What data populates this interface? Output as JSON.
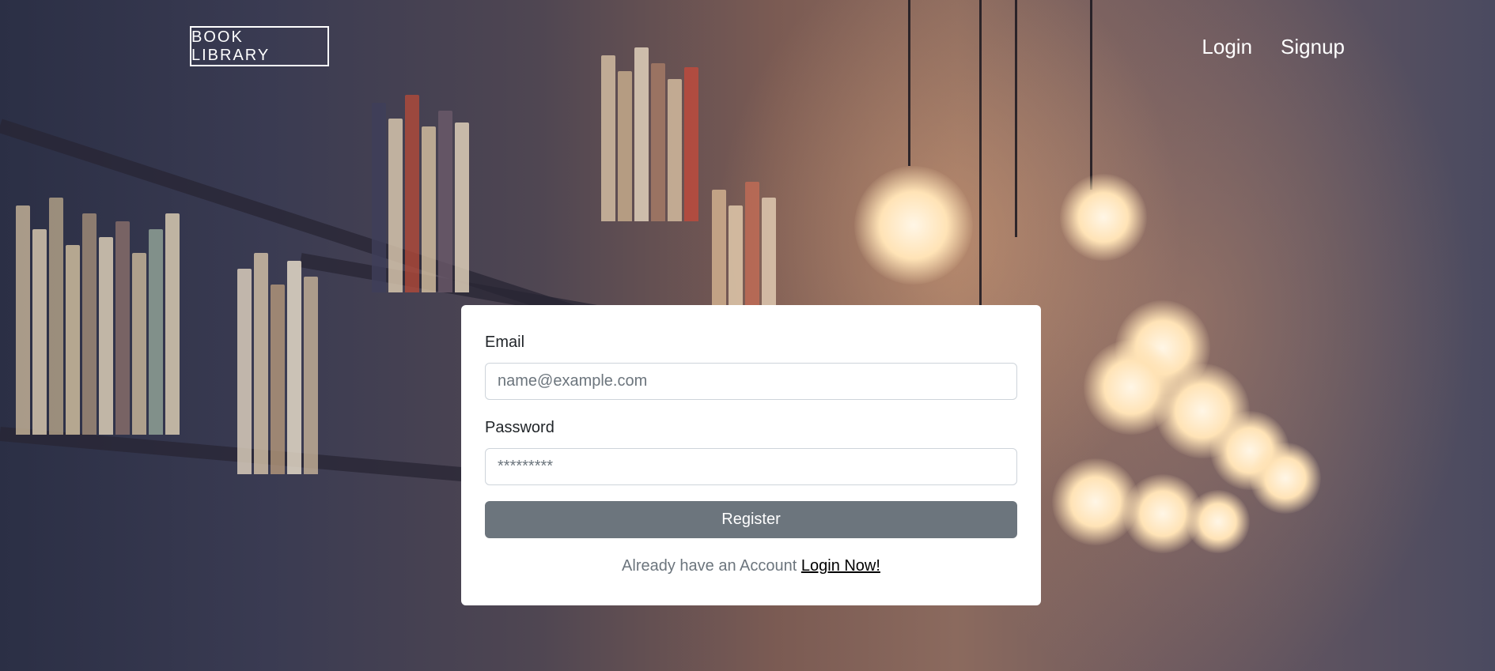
{
  "header": {
    "brand": "BOOK LIBRARY",
    "nav": {
      "login": "Login",
      "signup": "Signup"
    }
  },
  "form": {
    "email_label": "Email",
    "email_placeholder": "name@example.com",
    "password_label": "Password",
    "password_placeholder": "*********",
    "submit_label": "Register",
    "footer_text": "Already have an Account",
    "footer_link": "Login Now!"
  },
  "colors": {
    "button_bg": "#6c757d",
    "card_bg": "#ffffff",
    "nav_text": "#ffffff"
  }
}
